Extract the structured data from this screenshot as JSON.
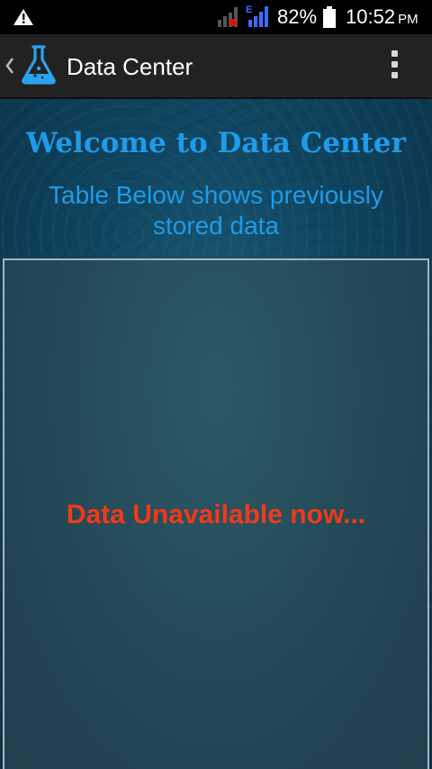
{
  "status_bar": {
    "battery_percent": "82%",
    "time": "10:52",
    "ampm": "PM",
    "network_type": "E",
    "icons": [
      "warning-icon",
      "signal-sim1-icon",
      "signal-sim2-icon",
      "battery-icon"
    ]
  },
  "action_bar": {
    "title": "Data Center",
    "icons": [
      "up-chevron-icon",
      "lab-flask-icon",
      "overflow-menu-icon"
    ]
  },
  "main": {
    "welcome_title": "Welcome to Data Center",
    "subtitle": "Table Below shows previously stored data",
    "empty_message": "Data Unavailable now..."
  },
  "colors": {
    "accent_blue": "#1e9be8",
    "error_red": "#ef3a1a",
    "action_bar_bg": "#222222"
  }
}
